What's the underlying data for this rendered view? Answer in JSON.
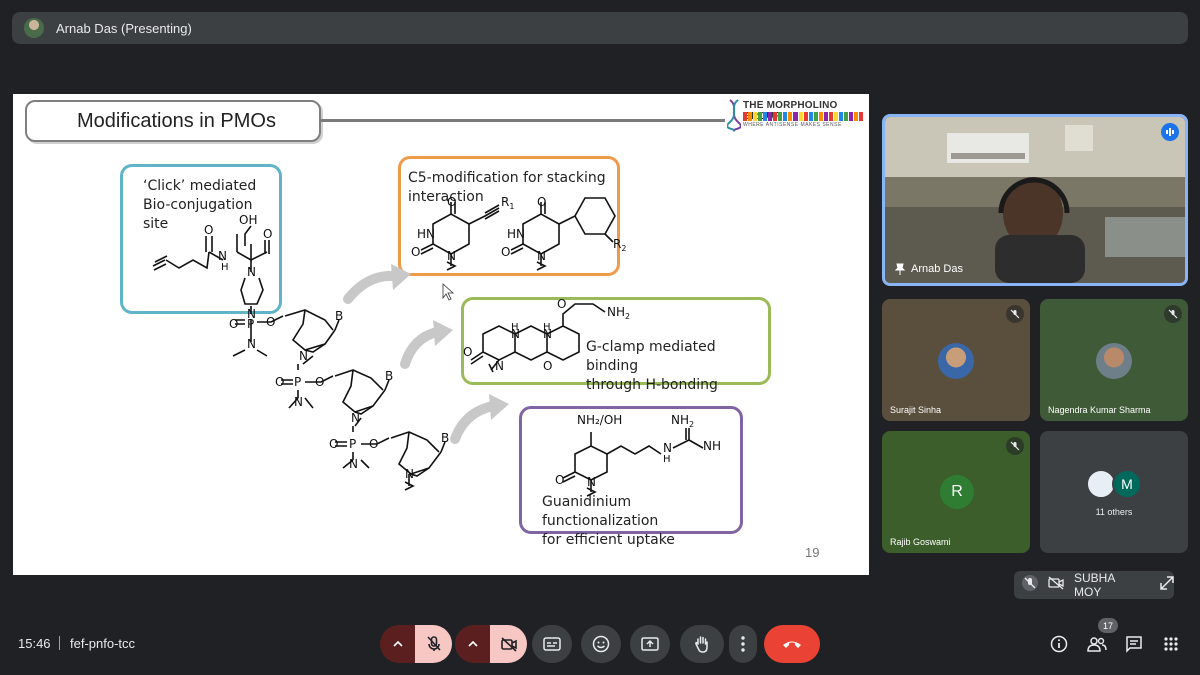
{
  "presenter": {
    "name": "Arnab Das (Presenting)"
  },
  "slide": {
    "title": "Modifications in PMOs",
    "logo_title": "THE MORPHOLINO GROUP",
    "logo_subtitle": "WHERE ANTISENSE MAKES SENSE",
    "page_number": "19",
    "boxes": {
      "click": [
        "‘Click’ mediated",
        "Bio-conjugation site"
      ],
      "c5": [
        "C5-modification for stacking",
        "interaction"
      ],
      "gclamp": [
        "G-clamp mediated binding",
        "through H-bonding"
      ],
      "guan": [
        "Guanidinium functionalization",
        "for efficient uptake"
      ]
    },
    "chem_labels": {
      "oh": "OH",
      "n": "N",
      "h": "H",
      "o": "O",
      "p": "P",
      "b": "B",
      "r1": "R",
      "r1_sub": "1",
      "r2": "R",
      "r2_sub": "2",
      "hn": "HN",
      "nh2": "NH",
      "nh2_sub": "2",
      "nh2oh": "NH₂/OH",
      "nh": "NH"
    }
  },
  "participants": {
    "main": {
      "name": "Arnab Das"
    },
    "tiles": [
      {
        "name": "Surajit Sinha"
      },
      {
        "name": "Nagendra Kumar Sharma"
      },
      {
        "name": "Rajib Goswami",
        "initial": "R"
      }
    ],
    "others": {
      "initial": "M",
      "label": "11 others"
    },
    "self": {
      "name": "SUBHA MOY"
    }
  },
  "bottom": {
    "time": "15:46",
    "meeting_code": "fef-pnfo-tcc",
    "people_count": "17"
  },
  "colors": {
    "click_box": "#5fb4c7",
    "c5_box": "#ef9a4a",
    "gclamp_box": "#9bbb59",
    "guan_box": "#8064a2",
    "end_call": "#ea4335",
    "active_speaker": "#8ab4f8"
  },
  "icons": [
    "mic-off-icon",
    "cam-off-icon",
    "captions-icon",
    "emoji-icon",
    "present-icon",
    "raise-hand-icon",
    "more-icon",
    "end-call-icon",
    "info-icon",
    "people-icon",
    "chat-icon",
    "activities-icon",
    "pin-icon"
  ]
}
